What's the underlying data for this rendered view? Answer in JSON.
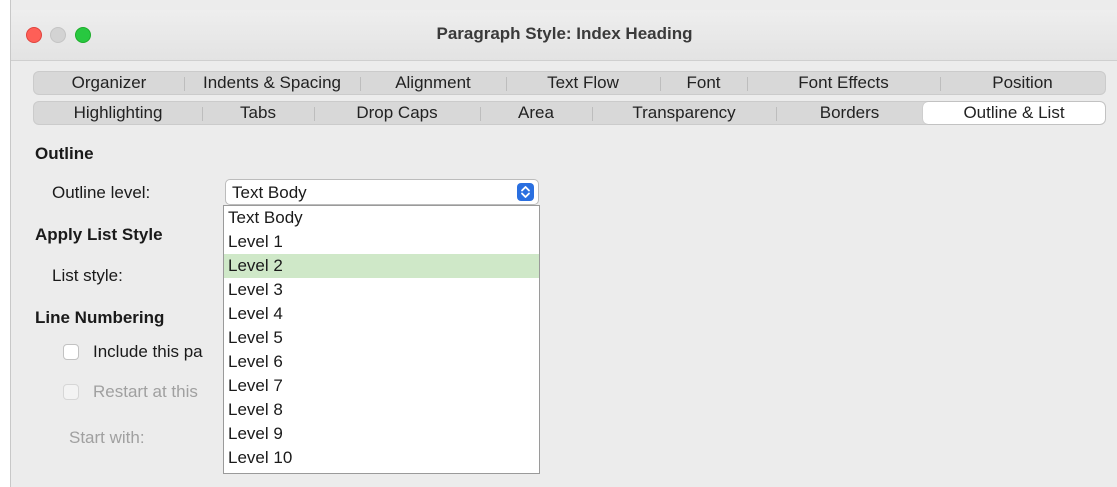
{
  "window": {
    "title": "Paragraph Style: Index Heading"
  },
  "tabs_row1": [
    "Organizer",
    "Indents & Spacing",
    "Alignment",
    "Text Flow",
    "Font",
    "Font Effects",
    "Position"
  ],
  "tabs_row2": [
    "Highlighting",
    "Tabs",
    "Drop Caps",
    "Area",
    "Transparency",
    "Borders",
    "Outline & List"
  ],
  "active_tab": "Outline & List",
  "outline": {
    "heading": "Outline",
    "level_label": "Outline level:",
    "level_value": "Text Body"
  },
  "list_style": {
    "heading": "Apply List Style",
    "label": "List style:"
  },
  "line_numbering": {
    "heading": "Line Numbering",
    "include_label": "Include this pa",
    "restart_label": "Restart at this",
    "start_with_label": "Start with:"
  },
  "dropdown": {
    "options": [
      "Text Body",
      "Level 1",
      "Level 2",
      "Level 3",
      "Level 4",
      "Level 5",
      "Level 6",
      "Level 7",
      "Level 8",
      "Level 9",
      "Level 10"
    ],
    "highlighted": "Level 2"
  },
  "colors": {
    "accent": "#2a6fe0",
    "highlight": "#cfe8c8",
    "close": "#fe5f57",
    "zoom": "#28c840"
  },
  "icons": {
    "stepper": "chevron-up-down-icon"
  }
}
